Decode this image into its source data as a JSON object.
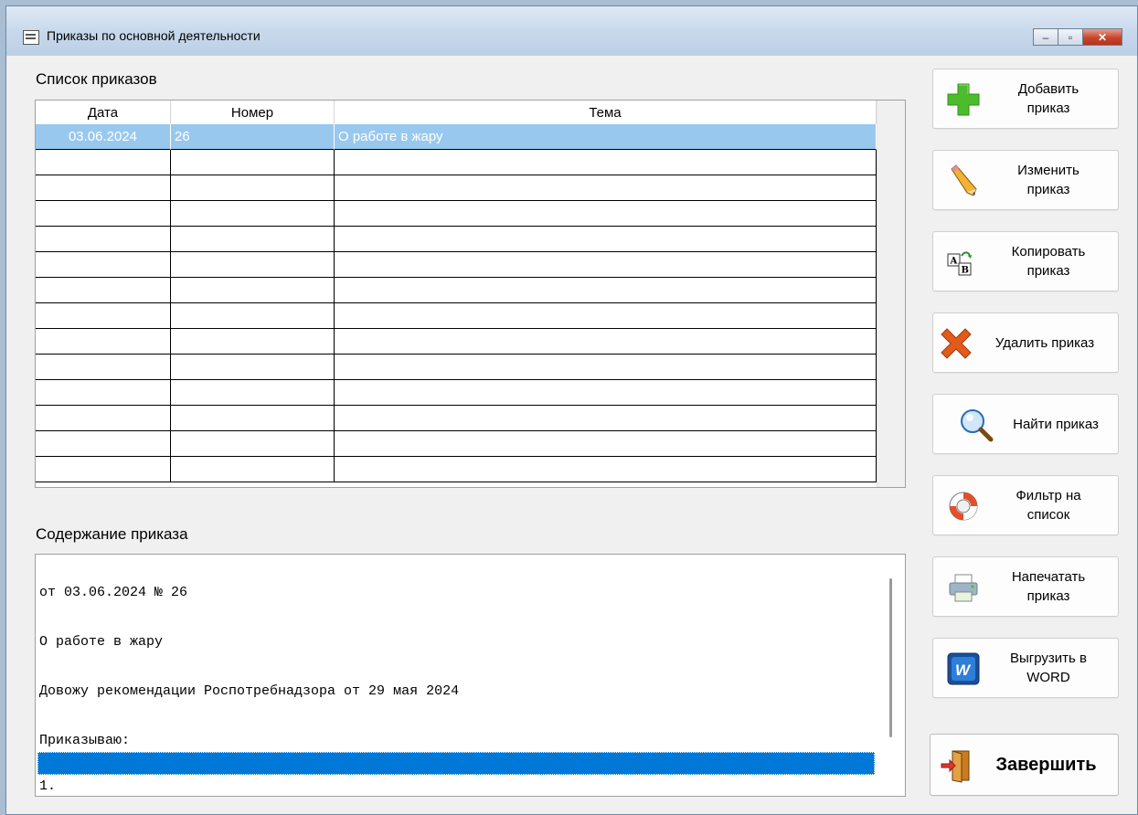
{
  "window": {
    "title": "Приказы по основной деятельности",
    "controls": {
      "minimize": "–",
      "maximize": "▫",
      "close": "✕"
    }
  },
  "list": {
    "label": "Список приказов",
    "columns": [
      "Дата",
      "Номер",
      "Тема"
    ],
    "rows": [
      {
        "date": "03.06.2024",
        "number": "26",
        "topic": "О работе в жару"
      }
    ],
    "empty_rows": 13
  },
  "content": {
    "label": "Содержание приказа",
    "lines": [
      "от 03.06.2024 № 26",
      "О работе в жару",
      "Довожу рекомендации Роспотребнадзора от 29 мая 2024",
      "Приказываю:",
      "1."
    ]
  },
  "buttons": {
    "add": "Добавить\nприказ",
    "edit": "Изменить\nприказ",
    "copy": "Копировать\nприказ",
    "delete": "Удалить приказ",
    "find": "Найти приказ",
    "filter": "Фильтр на\nсписок",
    "print": "Напечатать\nприказ",
    "export": "Выгрузить в\nWORD",
    "exit": "Завершить"
  },
  "icons": {
    "add": "plus-icon",
    "edit": "pencil-icon",
    "copy": "copy-ab-icon",
    "delete": "x-mark-icon",
    "find": "magnifier-icon",
    "filter": "lifebuoy-icon",
    "print": "printer-icon",
    "export": "word-icon",
    "exit": "exit-door-icon"
  },
  "colors": {
    "selection": "#99c8ef",
    "text_selection": "#0078d7",
    "add": "#4cbb2c",
    "delete": "#e25b1a"
  }
}
